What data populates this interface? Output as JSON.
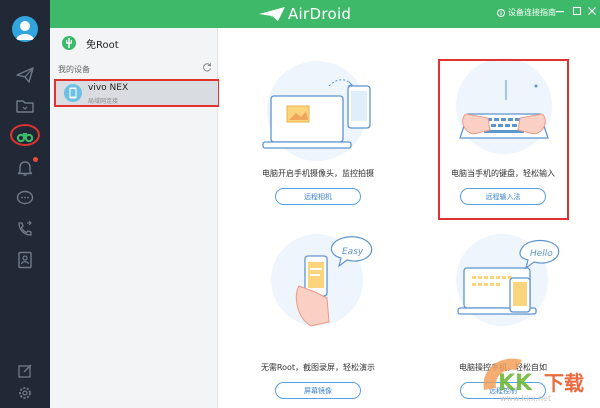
{
  "app": {
    "title": "AirDroid",
    "help_link": "设备连接指南"
  },
  "colors": {
    "brand": "#3eb969",
    "sidebar": "#212936",
    "accent_blue": "#3d85d1",
    "highlight_red": "#e0332f",
    "notification": "#e84b3c"
  },
  "sidebar": {
    "icons": [
      "avatar",
      "send-icon",
      "folder-icon",
      "binoculars-icon",
      "bell-icon",
      "chat-icon",
      "call-icon",
      "contacts-icon",
      "edit-icon",
      "settings-icon"
    ],
    "selected": "binoculars-icon"
  },
  "devices": {
    "root_label": "免Root",
    "section_label": "我的设备",
    "items": [
      {
        "name": "vivo NEX",
        "status": "局域网连接"
      }
    ]
  },
  "features": [
    {
      "title": "电脑开启手机摄像头，监控拍摄",
      "button": "远程相机",
      "icon": "remote-camera-illustration"
    },
    {
      "title": "电脑当手机的键盘，轻松输入",
      "button": "远程输入法",
      "icon": "remote-keyboard-illustration"
    },
    {
      "title": "无需Root，截图录屏，轻松演示",
      "button": "屏幕镜像",
      "icon": "screen-mirror-illustration"
    },
    {
      "title": "电脑操控手机，轻松自如",
      "button": "远程控制",
      "icon": "remote-control-illustration"
    }
  ],
  "watermark": {
    "url": "www.kkx.net"
  }
}
